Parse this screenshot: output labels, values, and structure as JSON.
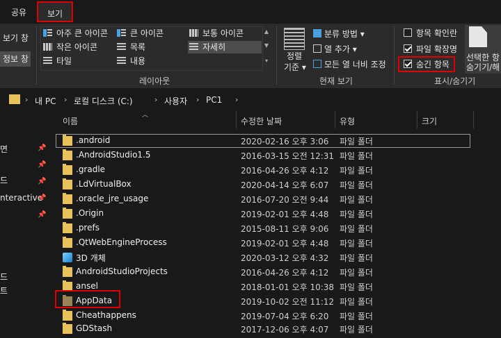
{
  "tabs": {
    "share": "공유",
    "view": "보기"
  },
  "ribbon": {
    "panes": {
      "preview": "보기 창",
      "details": "정보 창"
    },
    "layout": {
      "items": [
        "아주 큰 아이콘",
        "큰 아이콘",
        "보통 아이콘",
        "작은 아이콘",
        "목록",
        "자세히",
        "타일",
        "내용"
      ],
      "group_label": "레이아웃"
    },
    "current_view": {
      "sort_line1": "정렬",
      "sort_line2": "기준",
      "group_by": "분류 방법",
      "add_columns": "열 추가",
      "fit_columns": "모든 열 너비 조정",
      "group_label": "현재 보기"
    },
    "show_hide": {
      "item_checkboxes": "항목 확인란",
      "file_extensions": "파일 확장명",
      "hidden_items": "숨긴 항목",
      "hide_selected_line1": "선택한 항",
      "hide_selected_line2": "숨기기/해",
      "group_label": "표시/숨기기"
    }
  },
  "address": {
    "crumbs": [
      "내 PC",
      "로컬 디스크 (C:)",
      "사용자",
      "PC1"
    ]
  },
  "nav": {
    "items": [
      "면",
      "드",
      "nteractive",
      "드",
      "트"
    ]
  },
  "columns": {
    "name": "이름",
    "date": "수정한 날짜",
    "type": "유형",
    "size": "크기"
  },
  "files": [
    {
      "name": ".android",
      "date": "2020-02-16 오후 3:06",
      "type": "파일 폴더"
    },
    {
      "name": ".AndroidStudio1.5",
      "date": "2016-03-15 오전 12:31",
      "type": "파일 폴더"
    },
    {
      "name": ".gradle",
      "date": "2016-04-26 오후 4:12",
      "type": "파일 폴더"
    },
    {
      "name": ".LdVirtualBox",
      "date": "2020-04-14 오후 6:07",
      "type": "파일 폴더"
    },
    {
      "name": ".oracle_jre_usage",
      "date": "2016-07-20 오전 9:44",
      "type": "파일 폴더"
    },
    {
      "name": ".Origin",
      "date": "2019-02-01 오후 4:48",
      "type": "파일 폴더"
    },
    {
      "name": ".prefs",
      "date": "2015-08-11 오후 9:06",
      "type": "파일 폴더"
    },
    {
      "name": ".QtWebEngineProcess",
      "date": "2019-02-01 오후 4:48",
      "type": "파일 폴더"
    },
    {
      "name": "3D 개체",
      "date": "2020-03-12 오후 4:32",
      "type": "파일 폴더"
    },
    {
      "name": "AndroidStudioProjects",
      "date": "2016-04-26 오후 4:12",
      "type": "파일 폴더"
    },
    {
      "name": "ansel",
      "date": "2018-01-01 오후 10:38",
      "type": "파일 폴더"
    },
    {
      "name": "AppData",
      "date": "2019-10-02 오전 11:12",
      "type": "파일 폴더"
    },
    {
      "name": "Cheathappens",
      "date": "2019-07-04 오후 6:20",
      "type": "파일 폴더"
    },
    {
      "name": "GDStash",
      "date": "2017-12-06 오후 4:07",
      "type": "파일 폴더"
    }
  ]
}
